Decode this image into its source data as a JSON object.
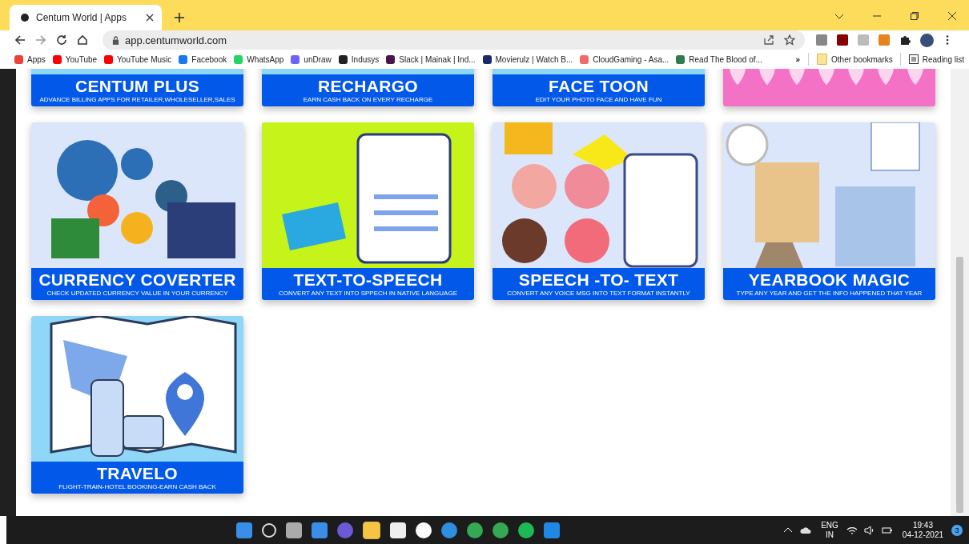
{
  "browser": {
    "tab": {
      "title": "Centum World | Apps",
      "selected": true
    },
    "url": "app.centumworld.com",
    "bookmarks": [
      {
        "label": "Apps"
      },
      {
        "label": "YouTube"
      },
      {
        "label": "YouTube Music"
      },
      {
        "label": "Facebook"
      },
      {
        "label": "WhatsApp"
      },
      {
        "label": "unDraw"
      },
      {
        "label": "Indusys"
      },
      {
        "label": "Slack | Mainak | Ind..."
      },
      {
        "label": "Movierulz | Watch B..."
      },
      {
        "label": "CloudGaming - Asa..."
      },
      {
        "label": "Read The Blood of..."
      }
    ],
    "more": "»",
    "other_bookmarks": "Other bookmarks",
    "reading_list": "Reading list"
  },
  "apps": [
    {
      "title": "CENTUM PLUS",
      "subtitle": "ADVANCE BILLING APPS FOR RETAILER,WHOLESELLER,SALES",
      "kind": "plain"
    },
    {
      "title": "RECHARGO",
      "subtitle": "EARN CASH BACK  ON EVERY RECHARGE",
      "kind": "plain"
    },
    {
      "title": "FACE  TOON",
      "subtitle": "EDIT YOUR PHOTO FACE AND HAVE FUN",
      "kind": "plain"
    },
    {
      "kind": "hearts"
    },
    {
      "title": "CURRENCY COVERTER",
      "subtitle": "CHECK UPDATED CURRENCY VALUE IN YOUR CURRENCY",
      "kind": "currency"
    },
    {
      "title": "TEXT-TO-SPEECH",
      "subtitle": "CONVERT ANY TEXT INTO SPPECH IN NATIVE LANGUAGE",
      "kind": "tablet"
    },
    {
      "title": "SPEECH -TO- TEXT",
      "subtitle": "CONVERT ANY VOICE MSG INTO TEXT FORMAT INSTANTLY",
      "kind": "chat"
    },
    {
      "title": "YEARBOOK MAGIC",
      "subtitle": "TYPE ANY YEAR AND GET THE INFO HAPPENED THAT YEAR",
      "kind": "history"
    },
    {
      "title": "TRAVELO",
      "subtitle": "FLIGHT-TRAIN-HOTEL BOOKING-EARN CASH BACK",
      "kind": "map"
    }
  ],
  "taskbar": {
    "language": "ENG",
    "region": "IN",
    "time": "19:43",
    "date": "04-12-2021",
    "notifications": "3"
  }
}
